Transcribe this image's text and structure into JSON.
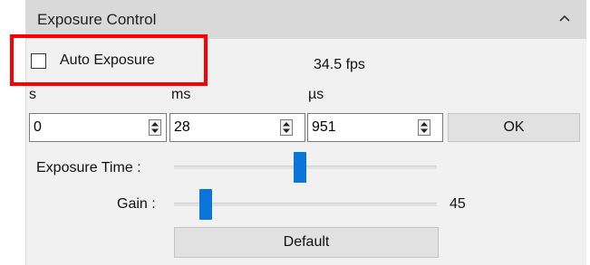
{
  "panel": {
    "title": "Exposure Control",
    "collapse_icon": "chevron-up-icon"
  },
  "auto_exposure": {
    "label": "Auto Exposure",
    "checked": false
  },
  "fps": "34.5 fps",
  "units": {
    "s": "s",
    "ms": "ms",
    "us": "µs"
  },
  "fields": {
    "s_value": "0",
    "ms_value": "28",
    "us_value": "951"
  },
  "ok_label": "OK",
  "exposure_time": {
    "label": "Exposure Time :",
    "level_fraction": 0.48
  },
  "gain": {
    "label": "Gain :",
    "value": "45",
    "level_fraction": 0.1
  },
  "default_label": "Default",
  "colors": {
    "highlight": "#ff0000",
    "slider_thumb": "#0a74d9",
    "header_bg": "#d9d9d9"
  }
}
